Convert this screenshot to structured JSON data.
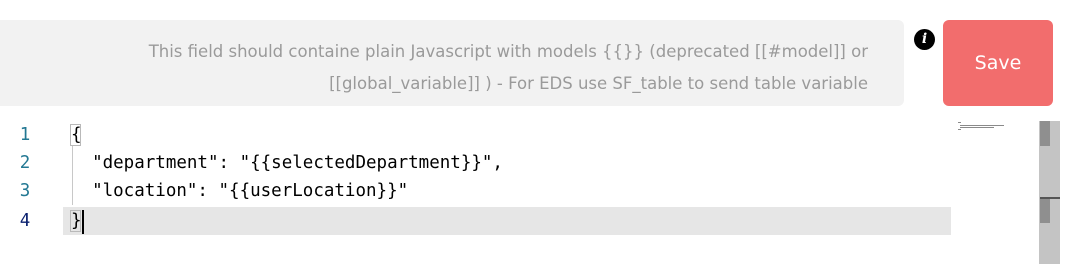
{
  "hint": {
    "line1": "This field should containe plain Javascript with models {{}} (deprecated [[#model]] or",
    "line2": "[[global_variable]] ) - For EDS use SF_table to send table variable"
  },
  "info_icon": {
    "glyph": "i",
    "icon": "info-icon"
  },
  "save_button": {
    "label": "Save",
    "color": "#f26d6d"
  },
  "editor": {
    "lines": [
      {
        "number": "1",
        "text": "{"
      },
      {
        "number": "2",
        "text": "  \"department\": \"{{selectedDepartment}}\","
      },
      {
        "number": "3",
        "text": "  \"location\": \"{{userLocation}}\""
      },
      {
        "number": "4",
        "text": "}"
      }
    ],
    "current_line": 4,
    "line_number_color": "#237893",
    "current_line_bg": "#e6e6e6"
  }
}
